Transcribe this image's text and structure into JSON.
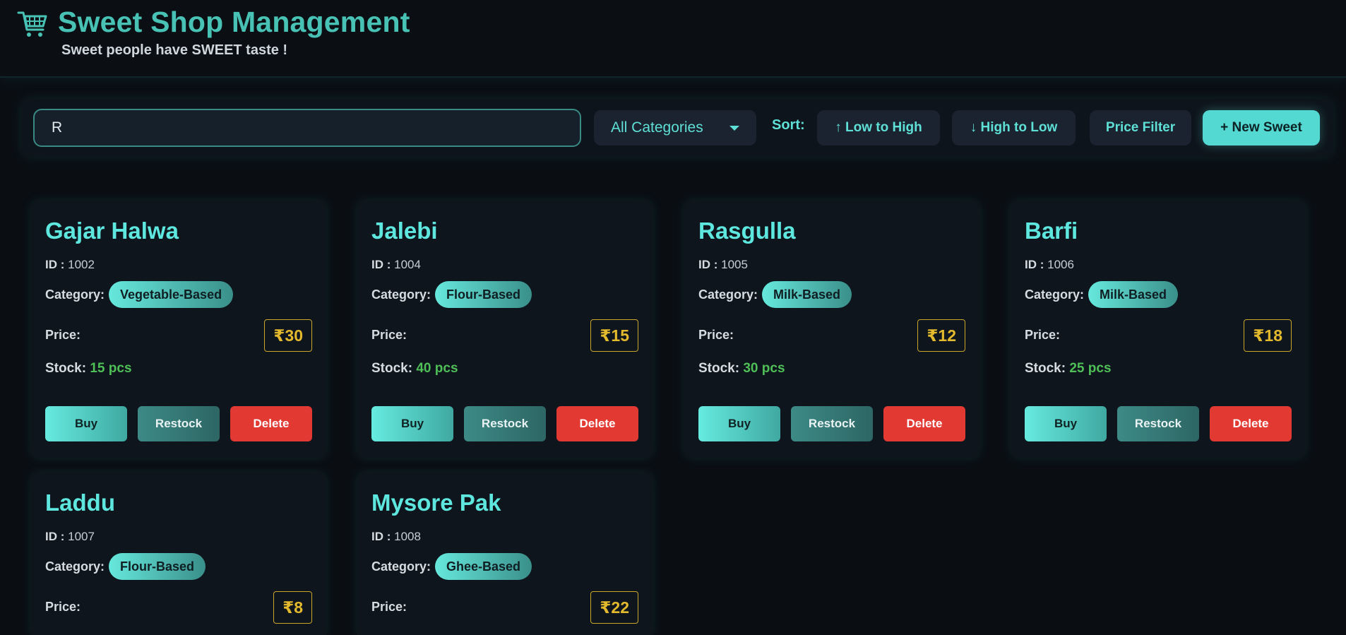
{
  "header": {
    "icon": "shopping-cart-icon",
    "title": "Sweet Shop Management",
    "tagline": "Sweet people have SWEET taste !"
  },
  "toolbar": {
    "search_value": "R",
    "category_selected": "All Categories",
    "sort_label": "Sort:",
    "sort_low_high": "↑ Low to High",
    "sort_high_low": "↓ High to Low",
    "price_filter": "Price Filter",
    "new_sweet": "+ New Sweet"
  },
  "labels": {
    "id": "ID :",
    "category": "Category:",
    "price": "Price:",
    "stock": "Stock:",
    "buy": "Buy",
    "restock": "Restock",
    "delete": "Delete"
  },
  "sweets": [
    {
      "name": "Gajar Halwa",
      "id": "1002",
      "category": "Vegetable-Based",
      "price": "₹30",
      "stock": "15 pcs"
    },
    {
      "name": "Jalebi",
      "id": "1004",
      "category": "Flour-Based",
      "price": "₹15",
      "stock": "40 pcs"
    },
    {
      "name": "Rasgulla",
      "id": "1005",
      "category": "Milk-Based",
      "price": "₹12",
      "stock": "30 pcs"
    },
    {
      "name": "Barfi",
      "id": "1006",
      "category": "Milk-Based",
      "price": "₹18",
      "stock": "25 pcs"
    },
    {
      "name": "Laddu",
      "id": "1007",
      "category": "Flour-Based",
      "price": "₹8",
      "stock": ""
    },
    {
      "name": "Mysore Pak",
      "id": "1008",
      "category": "Ghee-Based",
      "price": "₹22",
      "stock": ""
    }
  ],
  "colors": {
    "accent": "#5ee7df",
    "title": "#48c2b4",
    "price": "#e3b92d",
    "stock": "#4fbf57",
    "delete": "#e23a33",
    "background": "#0a0e13"
  }
}
